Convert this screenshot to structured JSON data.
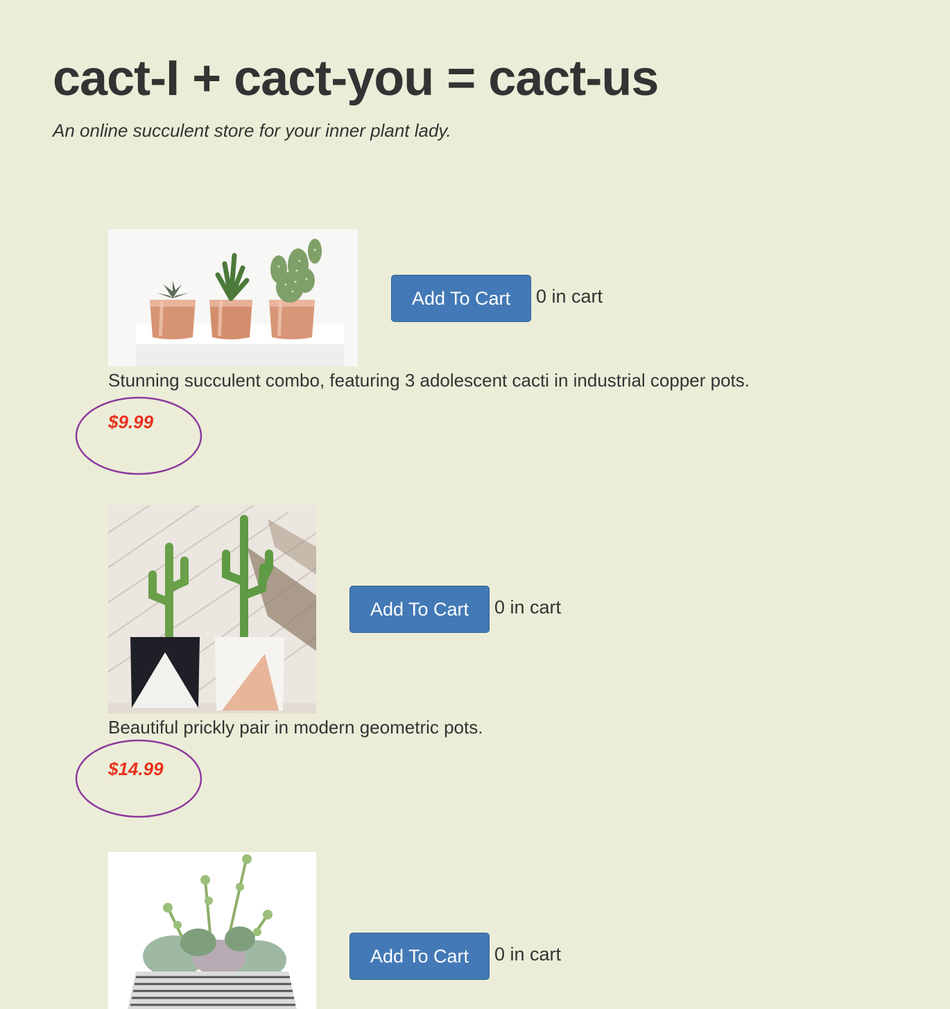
{
  "header": {
    "title": "cact-I + cact-you = cact-us",
    "subtitle": "An online succulent store for your inner plant lady."
  },
  "products": [
    {
      "button_label": "Add To Cart",
      "cart_count": "0 in cart",
      "description": "Stunning succulent combo, featuring 3 adolescent cacti in industrial copper pots.",
      "price": "$9.99"
    },
    {
      "button_label": "Add To Cart",
      "cart_count": "0 in cart",
      "description": "Beautiful prickly pair in modern geometric pots.",
      "price": "$14.99"
    },
    {
      "button_label": "Add To Cart",
      "cart_count": "0 in cart"
    }
  ],
  "colors": {
    "background": "#ecedd8",
    "button": "#4379b6",
    "price": "#e8321f",
    "price_circle": "#8e3a9d"
  }
}
